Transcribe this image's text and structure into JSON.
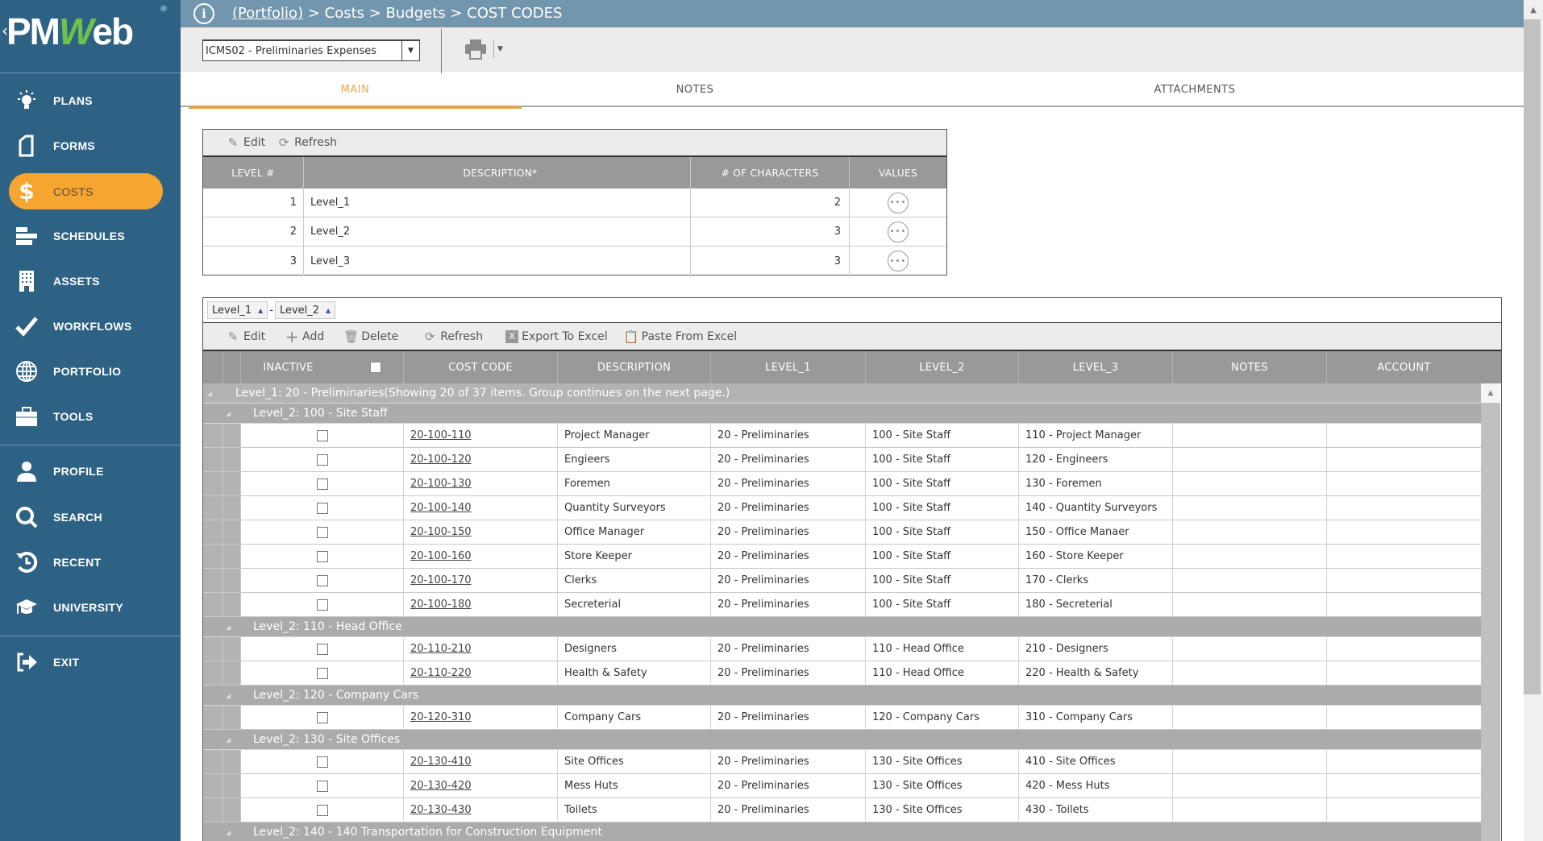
{
  "app": {
    "logo": {
      "prefix": "PM",
      "accent": "W",
      "suffix": "eb",
      "registered": "®"
    },
    "colors": {
      "sidebar": "#2e6285",
      "active": "#f6a531",
      "topbar": "#7196ad",
      "tab_active": "#f0a64a",
      "grid_header": "#999999"
    }
  },
  "sidebar": {
    "items": [
      {
        "label": "PLANS",
        "icon": "lightbulb-icon"
      },
      {
        "label": "FORMS",
        "icon": "document-icon"
      },
      {
        "label": "COSTS",
        "icon": "dollar-icon",
        "active": true
      },
      {
        "label": "SCHEDULES",
        "icon": "gantt-icon"
      },
      {
        "label": "ASSETS",
        "icon": "building-icon"
      },
      {
        "label": "WORKFLOWS",
        "icon": "checkmark-icon"
      },
      {
        "label": "PORTFOLIO",
        "icon": "globe-icon"
      },
      {
        "label": "TOOLS",
        "icon": "toolbox-icon"
      },
      {
        "label": "PROFILE",
        "icon": "user-icon"
      },
      {
        "label": "SEARCH",
        "icon": "search-icon"
      },
      {
        "label": "RECENT",
        "icon": "history-icon"
      },
      {
        "label": "UNIVERSITY",
        "icon": "graduation-cap-icon"
      },
      {
        "label": "EXIT",
        "icon": "exit-icon"
      }
    ]
  },
  "breadcrumb": {
    "portfolio": "(Portfolio)",
    "rest": " > Costs > Budgets > COST CODES"
  },
  "toolbar": {
    "selected_record": "ICMS02 - Preliminaries Expenses"
  },
  "tabs": [
    {
      "label": "MAIN",
      "active": true
    },
    {
      "label": "NOTES"
    },
    {
      "label": "ATTACHMENTS"
    }
  ],
  "levels_table": {
    "toolbar": {
      "edit": "Edit",
      "refresh": "Refresh"
    },
    "columns": [
      "LEVEL #",
      "DESCRIPTION*",
      "# OF CHARACTERS",
      "VALUES"
    ],
    "rows": [
      {
        "level": "1",
        "description": "Level_1",
        "chars": "2"
      },
      {
        "level": "2",
        "description": "Level_2",
        "chars": "3"
      },
      {
        "level": "3",
        "description": "Level_3",
        "chars": "3"
      }
    ]
  },
  "codes_grid": {
    "group_by": [
      "Level_1",
      "Level_2"
    ],
    "group_sep": "-",
    "toolbar": {
      "edit": "Edit",
      "add": "Add",
      "delete": "Delete",
      "refresh": "Refresh",
      "export": "Export To Excel",
      "paste": "Paste From Excel"
    },
    "columns": [
      "INACTIVE",
      "COST CODE",
      "DESCRIPTION",
      "LEVEL_1",
      "LEVEL_2",
      "LEVEL_3",
      "NOTES",
      "ACCOUNT"
    ],
    "level1_group": "Level_1: 20 - Preliminaries(Showing 20 of 37 items. Group continues on the next page.)",
    "groups": [
      {
        "title": "Level_2: 100 - Site Staff",
        "rows": [
          {
            "code": "20-100-110",
            "description": "Project Manager",
            "level1": "20 - Preliminaries",
            "level2": "100 - Site Staff",
            "level3": "110 - Project Manager",
            "notes": "",
            "account": ""
          },
          {
            "code": "20-100-120",
            "description": "Engieers",
            "level1": "20 - Preliminaries",
            "level2": "100 - Site Staff",
            "level3": "120 - Engineers",
            "notes": "",
            "account": ""
          },
          {
            "code": "20-100-130",
            "description": "Foremen",
            "level1": "20 - Preliminaries",
            "level2": "100 - Site Staff",
            "level3": "130 - Foremen",
            "notes": "",
            "account": ""
          },
          {
            "code": "20-100-140",
            "description": "Quantity Surveyors",
            "level1": "20 - Preliminaries",
            "level2": "100 - Site Staff",
            "level3": "140 - Quantity Surveyors",
            "notes": "",
            "account": ""
          },
          {
            "code": "20-100-150",
            "description": "Office Manager",
            "level1": "20 - Preliminaries",
            "level2": "100 - Site Staff",
            "level3": "150 - Office Manaer",
            "notes": "",
            "account": ""
          },
          {
            "code": "20-100-160",
            "description": "Store Keeper",
            "level1": "20 - Preliminaries",
            "level2": "100 - Site Staff",
            "level3": "160 - Store Keeper",
            "notes": "",
            "account": ""
          },
          {
            "code": "20-100-170",
            "description": "Clerks",
            "level1": "20 - Preliminaries",
            "level2": "100 - Site Staff",
            "level3": "170 - Clerks",
            "notes": "",
            "account": ""
          },
          {
            "code": "20-100-180",
            "description": "Secreterial",
            "level1": "20 - Preliminaries",
            "level2": "100 - Site Staff",
            "level3": "180 - Secreterial",
            "notes": "",
            "account": ""
          }
        ]
      },
      {
        "title": "Level_2: 110 - Head Office",
        "rows": [
          {
            "code": "20-110-210",
            "description": "Designers",
            "level1": "20 - Preliminaries",
            "level2": "110 - Head Office",
            "level3": "210 - Designers",
            "notes": "",
            "account": ""
          },
          {
            "code": "20-110-220",
            "description": "Health & Safety",
            "level1": "20 - Preliminaries",
            "level2": "110 - Head Office",
            "level3": "220 - Health & Safety",
            "notes": "",
            "account": ""
          }
        ]
      },
      {
        "title": "Level_2: 120 - Company Cars",
        "rows": [
          {
            "code": "20-120-310",
            "description": "Company Cars",
            "level1": "20 - Preliminaries",
            "level2": "120 - Company Cars",
            "level3": "310 - Company Cars",
            "notes": "",
            "account": ""
          }
        ]
      },
      {
        "title": "Level_2: 130 - Site Offices",
        "rows": [
          {
            "code": "20-130-410",
            "description": "Site Offices",
            "level1": "20 - Preliminaries",
            "level2": "130 - Site Offices",
            "level3": "410 - Site Offices",
            "notes": "",
            "account": ""
          },
          {
            "code": "20-130-420",
            "description": "Mess Huts",
            "level1": "20 - Preliminaries",
            "level2": "130 - Site Offices",
            "level3": "420 - Mess Huts",
            "notes": "",
            "account": ""
          },
          {
            "code": "20-130-430",
            "description": "Toilets",
            "level1": "20 - Preliminaries",
            "level2": "130 - Site Offices",
            "level3": "430 - Toilets",
            "notes": "",
            "account": ""
          }
        ]
      },
      {
        "title": "Level_2: 140 - 140 Transportation for Construction Equipment",
        "rows": []
      }
    ]
  }
}
